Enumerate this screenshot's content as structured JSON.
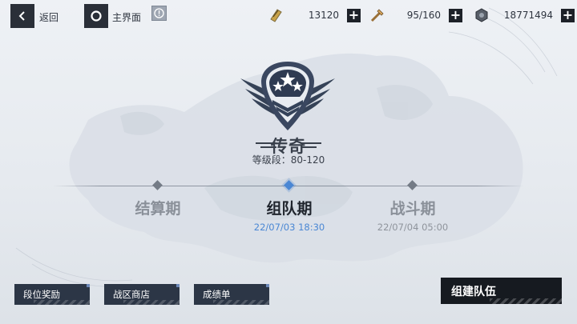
{
  "header": {
    "back_label": "返回",
    "main_menu_label": "主界面",
    "info_icon": "exclamation-icon"
  },
  "resources": [
    {
      "name": "ticket",
      "icon": "ticket-icon",
      "value": "13120"
    },
    {
      "name": "energy",
      "icon": "stamina-icon",
      "value": "95/160"
    },
    {
      "name": "currency",
      "icon": "coin-icon",
      "value": "18771494"
    }
  ],
  "rank": {
    "name": "传奇",
    "range": "等级段：80-120"
  },
  "phases": [
    {
      "label": "结算期",
      "date": "",
      "active": false
    },
    {
      "label": "组队期",
      "date": "22/07/03  18:30",
      "active": true
    },
    {
      "label": "战斗期",
      "date": "22/07/04  05:00",
      "active": false
    }
  ],
  "buttons": {
    "rank_reward": "段位奖励",
    "zone_shop": "战区商店",
    "score_sheet": "成绩单",
    "form_team": "组建队伍"
  },
  "colors": {
    "accent": "#4a87d4",
    "dark": "#2c3646",
    "emblem": "#354257"
  }
}
